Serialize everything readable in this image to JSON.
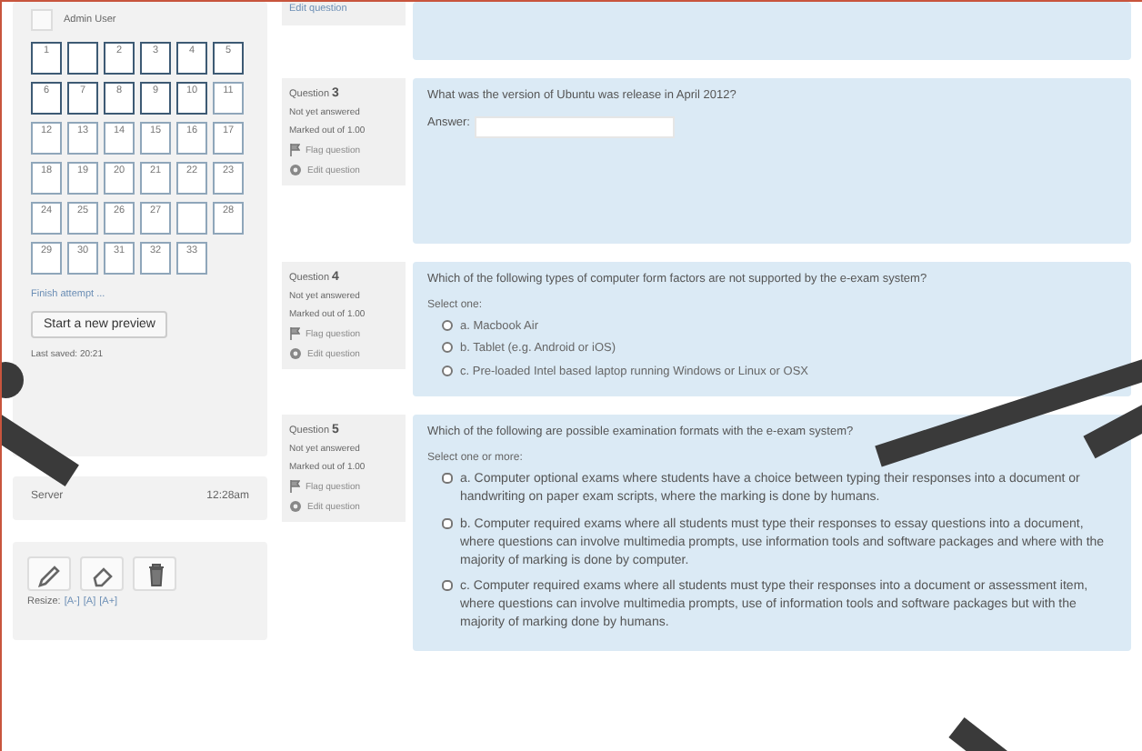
{
  "navigation": {
    "user_name": "Admin User",
    "buttons": [
      {
        "label": "1",
        "kind": "question",
        "current": true
      },
      {
        "kind": "description",
        "current": true
      },
      {
        "label": "2",
        "kind": "question",
        "current": true
      },
      {
        "label": "3",
        "kind": "question",
        "current": true
      },
      {
        "label": "4",
        "kind": "question",
        "current": true
      },
      {
        "label": "5",
        "kind": "question",
        "current": true
      },
      {
        "label": "6",
        "kind": "question",
        "current": true
      },
      {
        "label": "7",
        "kind": "question",
        "current": true
      },
      {
        "label": "8",
        "kind": "question",
        "current": true
      },
      {
        "label": "9",
        "kind": "question",
        "current": true
      },
      {
        "label": "10",
        "kind": "question",
        "current": true
      },
      {
        "label": "11",
        "kind": "question",
        "current": false
      },
      {
        "label": "12",
        "kind": "question",
        "current": false
      },
      {
        "label": "13",
        "kind": "question",
        "current": false
      },
      {
        "label": "14",
        "kind": "question",
        "current": false
      },
      {
        "label": "15",
        "kind": "question",
        "current": false
      },
      {
        "label": "16",
        "kind": "question",
        "current": false
      },
      {
        "label": "17",
        "kind": "question",
        "current": false
      },
      {
        "label": "18",
        "kind": "question",
        "current": false
      },
      {
        "label": "19",
        "kind": "question",
        "current": false
      },
      {
        "label": "20",
        "kind": "question",
        "current": false
      },
      {
        "label": "21",
        "kind": "question",
        "current": false
      },
      {
        "label": "22",
        "kind": "question",
        "current": false
      },
      {
        "label": "23",
        "kind": "question",
        "current": false
      },
      {
        "label": "24",
        "kind": "question",
        "current": false
      },
      {
        "label": "25",
        "kind": "question",
        "current": false
      },
      {
        "label": "26",
        "kind": "question",
        "current": false
      },
      {
        "label": "27",
        "kind": "question",
        "current": false
      },
      {
        "kind": "description",
        "current": false
      },
      {
        "label": "28",
        "kind": "question",
        "current": false
      },
      {
        "label": "29",
        "kind": "question",
        "current": false
      },
      {
        "label": "30",
        "kind": "question",
        "current": false
      },
      {
        "label": "31",
        "kind": "question",
        "current": false
      },
      {
        "label": "32",
        "kind": "question",
        "current": false
      },
      {
        "label": "33",
        "kind": "question",
        "current": false
      }
    ],
    "finish_link": "Finish attempt ...",
    "preview_button": "Start a new preview",
    "last_saved": "Last saved: 20:21"
  },
  "timer": {
    "label": "Server",
    "time": "12:28am"
  },
  "tools": {
    "resize_label": "Resize:",
    "resize_links": [
      "[A-]",
      "[A]",
      "[A+]"
    ]
  },
  "previous_question": {
    "edit_label": "Edit question"
  },
  "questions": [
    {
      "number_label": "Question ",
      "number": "3",
      "state": "Not yet answered",
      "mark": "Marked out of 1.00",
      "flag": "Flag question",
      "edit": "Edit question",
      "text": "What was the version of Ubuntu was release in April 2012?",
      "kind": "short_answer",
      "answer_label": "Answer:"
    },
    {
      "number_label": "Question ",
      "number": "4",
      "state": "Not yet answered",
      "mark": "Marked out of 1.00",
      "flag": "Flag question",
      "edit": "Edit question",
      "text": "Which of the following types of computer form factors are not supported by the e-exam system?",
      "kind": "single_choice",
      "prompt": "Select one:",
      "options": [
        {
          "label": "a. Macbook Air",
          "selected": false
        },
        {
          "label": "b. Tablet (e.g. Android or iOS)",
          "selected": false
        },
        {
          "label": "c. Pre-loaded Intel based laptop running Windows or Linux or OSX",
          "selected": false
        }
      ]
    },
    {
      "number_label": "Question ",
      "number": "5",
      "state": "Not yet answered",
      "mark": "Marked out of 1.00",
      "flag": "Flag question",
      "edit": "Edit question",
      "text": "Which of the following are possible examination formats with the e-exam system?",
      "kind": "multiple_choice",
      "prompt": "Select one or more:",
      "options": [
        {
          "label": "a. Computer optional exams where students have a choice between typing their responses into a document or handwriting on paper exam scripts, where the marking is done by humans.",
          "selected": false
        },
        {
          "label": "b. Computer required exams where all students must type their responses to essay questions into a document, where questions can involve multimedia prompts, use information tools and software packages and where with the majority of marking is done by computer.",
          "selected": false
        },
        {
          "label": "c. Computer required exams where all students must type their responses into a document or assessment item, where questions can involve multimedia prompts, use of information tools and software packages but with the majority of marking done by humans.",
          "selected": false
        }
      ]
    }
  ]
}
